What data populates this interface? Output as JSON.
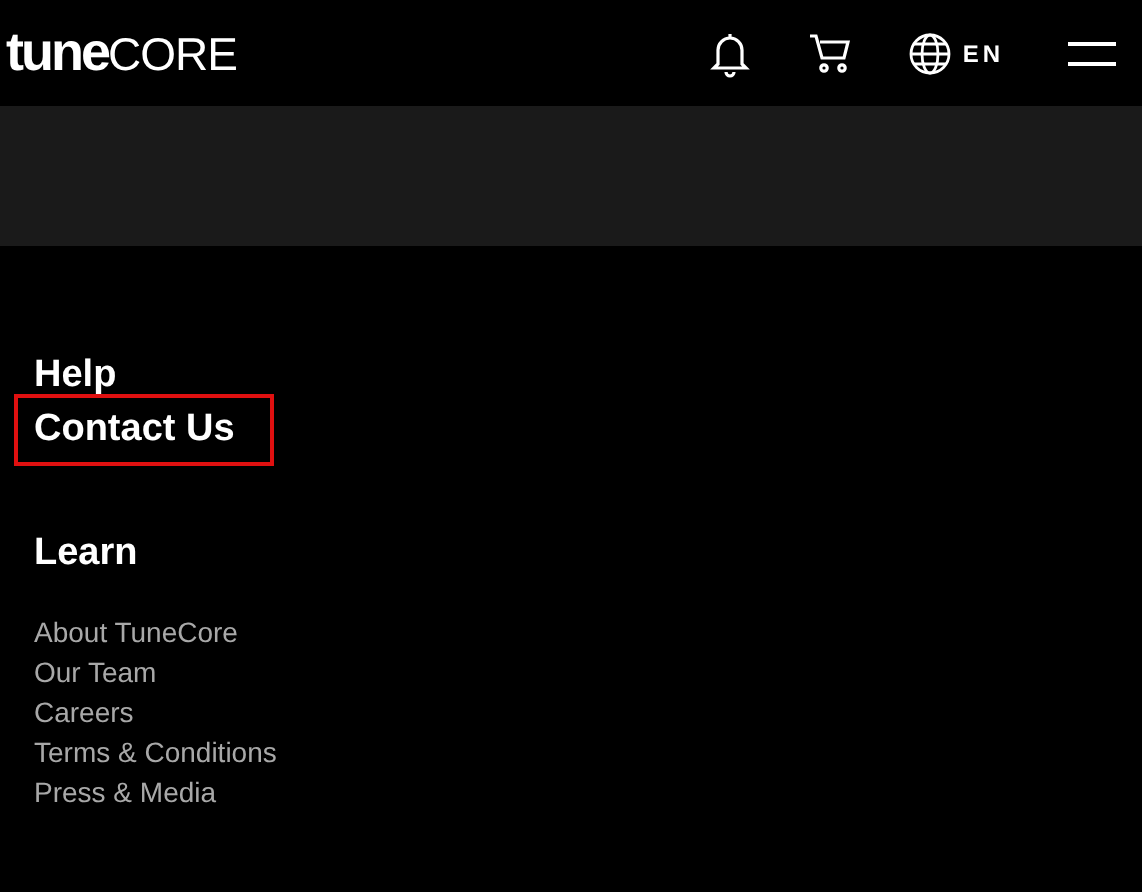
{
  "header": {
    "logo": {
      "bold": "tune",
      "light": "CORE"
    },
    "language": "EN"
  },
  "help": {
    "title": "Help",
    "links": [
      {
        "label": "Contact Us",
        "highlighted": true
      }
    ]
  },
  "learn": {
    "title": "Learn",
    "links": [
      "About TuneCore",
      "Our Team",
      "Careers",
      "Terms & Conditions",
      "Press & Media"
    ]
  }
}
